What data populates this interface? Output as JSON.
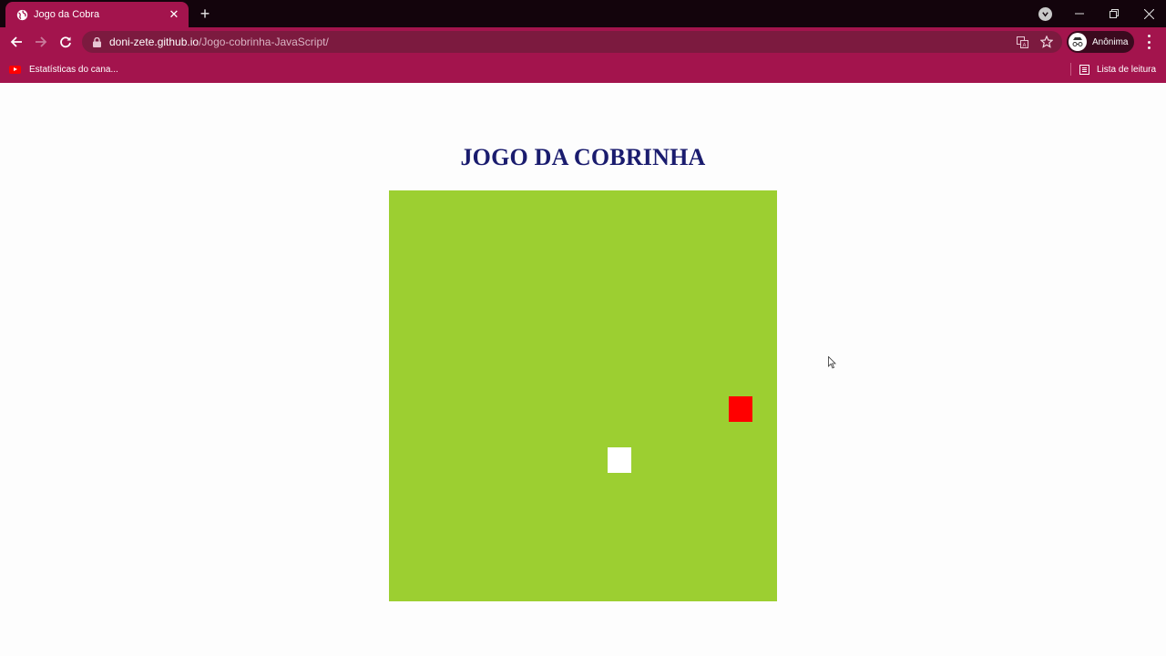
{
  "browser": {
    "tab": {
      "title": "Jogo da Cobra",
      "close_glyph": "✕"
    },
    "new_tab_glyph": "+",
    "address": {
      "host": "doni-zete.github.io",
      "path": "/Jogo-cobrinha-JavaScript/"
    },
    "profile_label": "Anônima",
    "bookmarks": [
      {
        "label": "Estatísticas do cana...",
        "icon": "youtube-icon"
      }
    ],
    "reading_list_label": "Lista de leitura",
    "window_controls": {
      "minimize": "–",
      "restore": "❐",
      "close": "✕"
    },
    "accent_color": "#a3144d"
  },
  "game": {
    "title": "JOGO DA COBRINHA",
    "board_color": "#9ccf31",
    "food_color": "#ff0000",
    "snake_color": "#ffffff",
    "grid": {
      "cols": 16,
      "rows": 16
    },
    "food_cell": {
      "col": 14,
      "row": 8
    },
    "snake_cells": [
      {
        "col": 9,
        "row": 10
      }
    ]
  }
}
